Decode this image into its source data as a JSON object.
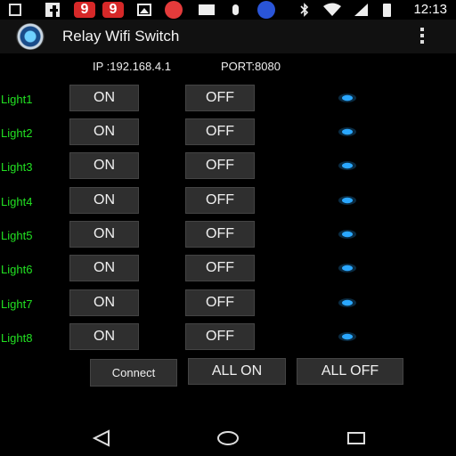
{
  "status_bar": {
    "time": "12:13",
    "icons": [
      "notification-square-icon",
      "facebook-icon",
      "app-9-icon",
      "app-9-icon",
      "image-icon",
      "music-icon",
      "mail-icon",
      "mic-icon",
      "sync-icon",
      "bluetooth-icon",
      "wifi-icon",
      "signal-icon",
      "battery-icon"
    ]
  },
  "app_bar": {
    "title": "Relay Wifi Switch"
  },
  "connection": {
    "ip_label": "IP :192.168.4.1",
    "port_label": "PORT:8080"
  },
  "lights": [
    {
      "label": "Light1",
      "on": "ON",
      "off": "OFF"
    },
    {
      "label": "Light2",
      "on": "ON",
      "off": "OFF"
    },
    {
      "label": "Light3",
      "on": "ON",
      "off": "OFF"
    },
    {
      "label": "Light4",
      "on": "ON",
      "off": "OFF"
    },
    {
      "label": "Light5",
      "on": "ON",
      "off": "OFF"
    },
    {
      "label": "Light6",
      "on": "ON",
      "off": "OFF"
    },
    {
      "label": "Light7",
      "on": "ON",
      "off": "OFF"
    },
    {
      "label": "Light8",
      "on": "ON",
      "off": "OFF"
    }
  ],
  "bottom_buttons": {
    "connect": "Connect",
    "all_on": "ALL ON",
    "all_off": "ALL OFF"
  },
  "colors": {
    "label_green": "#22e122",
    "button_bg": "#2f2f2f",
    "led_blue": "#2aa7ff"
  },
  "nav_bar": {
    "icons": [
      "back-icon",
      "home-icon",
      "recents-icon"
    ]
  }
}
